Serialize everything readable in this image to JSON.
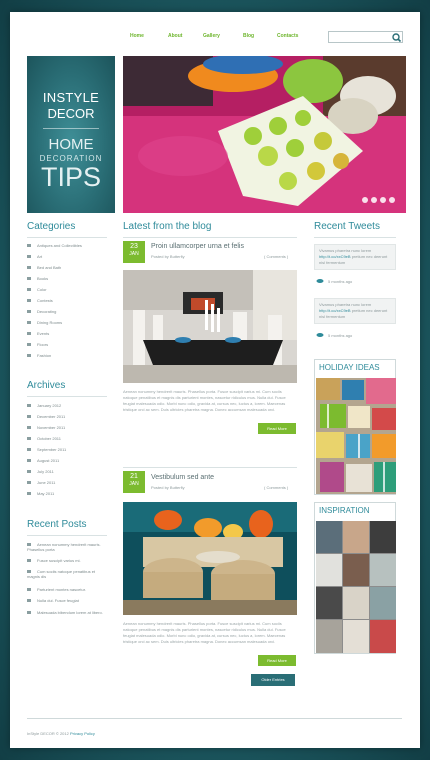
{
  "nav": {
    "items": [
      "Home",
      "About",
      "Gallery",
      "Blog",
      "Contacts"
    ]
  },
  "search": {
    "placeholder": ""
  },
  "logo": {
    "line1": "INSTYLE",
    "line2": "DECOR",
    "line3": "HOME",
    "line4": "DECORATION",
    "line5": "TIPS"
  },
  "categories": {
    "title": "Categories",
    "items": [
      "Antiques and Collectibles",
      "Art",
      "Bed and Bath",
      "Books",
      "Color",
      "Contests",
      "Decorating",
      "Dining Rooms",
      "Events",
      "Floors",
      "Fashion"
    ]
  },
  "archives": {
    "title": "Archives",
    "items": [
      "January 2012",
      "December 2011",
      "November 2011",
      "October 2011",
      "September 2011",
      "August 2011",
      "July 2011",
      "June 2011",
      "May 2011"
    ]
  },
  "recent_posts": {
    "title": "Recent Posts",
    "items": [
      "Aenean nonummy hendrerit mauris. Phasellus porta",
      "Fusce suscipit varius mi.",
      "Cum sociis natoque penatibus et magnis dis",
      "Parturient montes nascetur.",
      "Nulla dui. Fusce feugiat",
      "Malesuada bibendum lorem at libero."
    ]
  },
  "blog": {
    "title": "Latest from the blog",
    "posts": [
      {
        "day": "23",
        "month": "JAN",
        "title": "Proin ullamcorper urna et felis",
        "author": "Posted by Butterfly",
        "comments": "( Comments )",
        "excerpt": "Aenean nonummy hendrerit mauris. Phasellus porta. Fusce suscipit varius mi. Cum sociis natoque penatibus et magnis dis parturient montes, nascetur ridiculus mus. Nulla dui. Fusce feugiat malesuada odio. Morbi nunc odio, gravida at, cursus nec, luctus a, lorem. Maecenas tristique orci ac sem. Duis ultricies pharetra magna. Donec accumsan malesuada orci.",
        "button": "Read More"
      },
      {
        "day": "21",
        "month": "JAN",
        "title": "Vestibulum sed ante",
        "author": "Posted by Butterfly",
        "comments": "( Comments )",
        "excerpt": "Aenean nonummy hendrerit mauris. Phasellus porta. Fusce suscipit varius mi. Cum sociis natoque penatibus et magnis dis parturient montes, nascetur ridiculus mus. Nulla dui. Fusce feugiat malesuada odio. Morbi nunc odio, gravida at, cursus nec, luctus a, lorem. Maecenas tristique orci ac sem. Duis ultricies pharetra magna. Donec accumsan malesuada orci.",
        "button": "Read More"
      }
    ],
    "older_button": "Older Entries"
  },
  "tweets": {
    "title": "Recent Tweets",
    "items": [
      {
        "text": "Vivamus pharetra nunc lorem",
        "link": "http://t.co/xxC9eB",
        "rest": "pretium nec deerunt nisl fermentum",
        "time": "5 months ago"
      },
      {
        "text": "Vivamus pharetra nunc lorem",
        "link": "http://t.co/xxC9eB",
        "rest": "pretium nec deerunt nisl fermentum",
        "time": "5 months ago"
      }
    ]
  },
  "widgets": {
    "holiday": "HOLIDAY IDEAS",
    "inspiration": "INSPIRATION"
  },
  "footer": {
    "text": "InStyle DECOR © 2012",
    "privacy": "Privacy Policy"
  },
  "colors": {
    "accent": "#7cbb2f",
    "teal": "#2a6e76",
    "heading": "#2f8b9a"
  }
}
